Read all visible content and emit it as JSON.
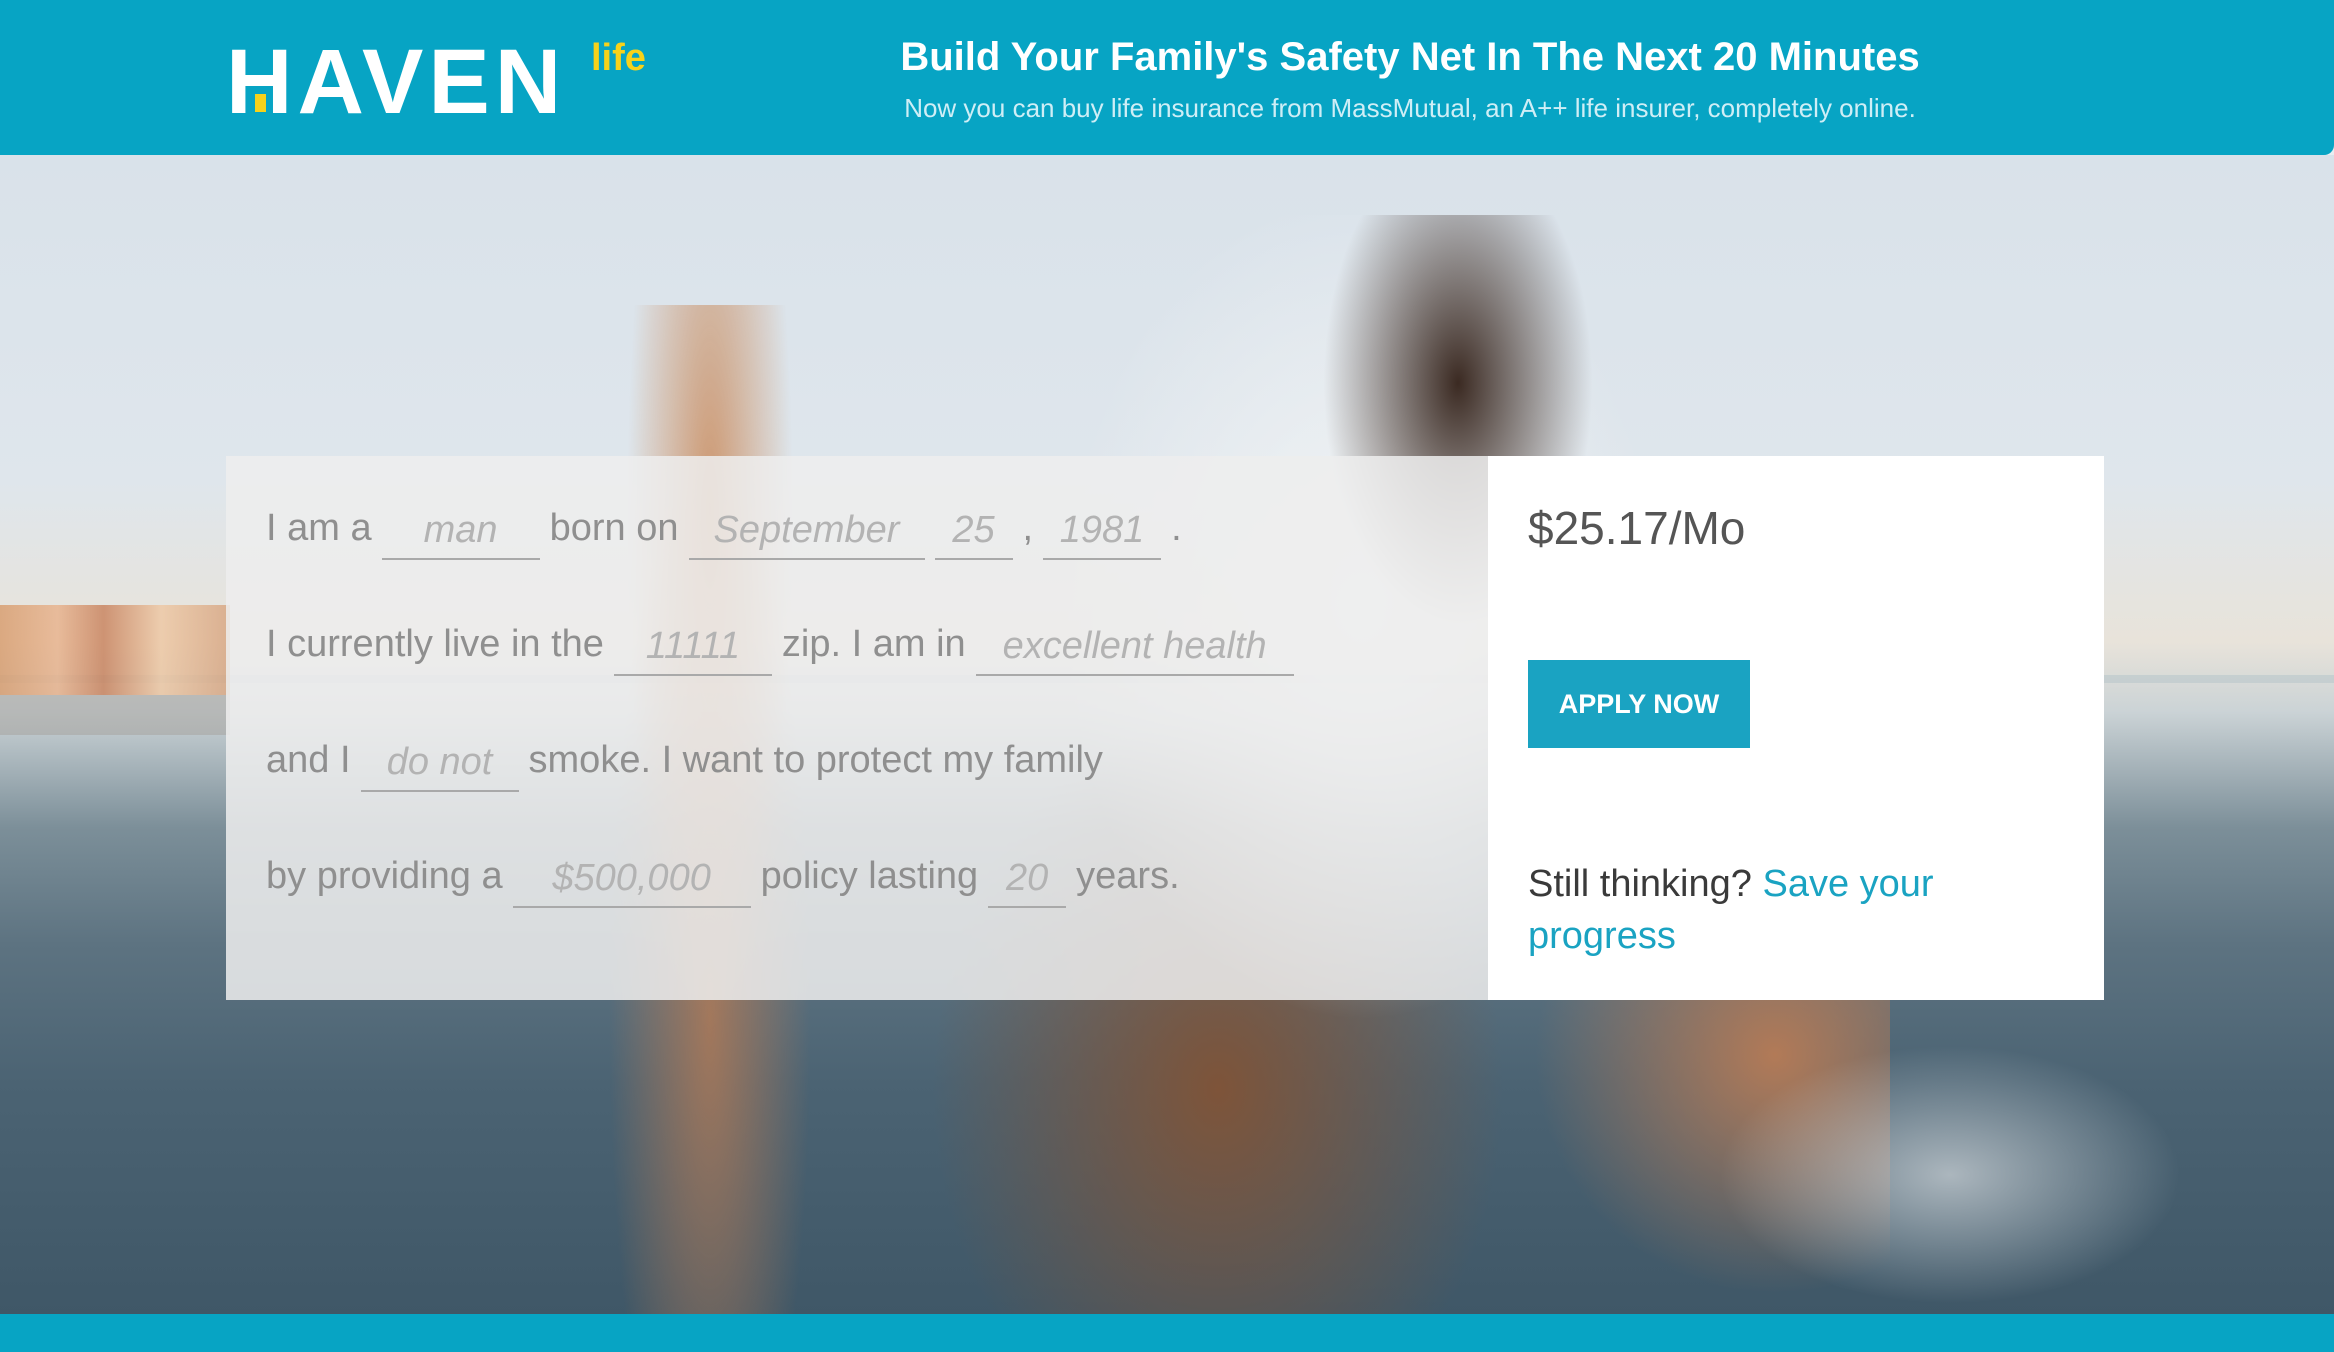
{
  "header": {
    "logo_text": "HAVEN",
    "logo_suffix": "life",
    "title": "Build Your Family's Safety Net In The Next 20 Minutes",
    "subtitle": "Now you can buy life insurance from MassMutual, an A++ life insurer, completely online."
  },
  "form": {
    "line1": {
      "text_a": "I am a",
      "gender": "man",
      "text_b": "born on",
      "birth_month": "September",
      "birth_day": "25",
      "sep_comma": ",",
      "birth_year": "1981",
      "sep_period": "."
    },
    "line2": {
      "text_a": "I currently live in the",
      "zip": "11111",
      "text_b": "zip. I am in",
      "health": "excellent health"
    },
    "line3": {
      "text_a": "and I",
      "smoker": "do not",
      "text_b": "smoke. I want to protect my family"
    },
    "line4": {
      "text_a": "by providing a",
      "coverage": "$500,000",
      "text_b": "policy lasting",
      "term": "20",
      "text_c": "years."
    }
  },
  "quote": {
    "price": "$25.17/Mo",
    "apply_label": "APPLY NOW",
    "still_thinking": "Still thinking?",
    "save_link": "Save your progress"
  },
  "colors": {
    "brand": "#07a4c4",
    "accent": "#1aa3c2",
    "logo_yellow": "#f7d21a"
  }
}
